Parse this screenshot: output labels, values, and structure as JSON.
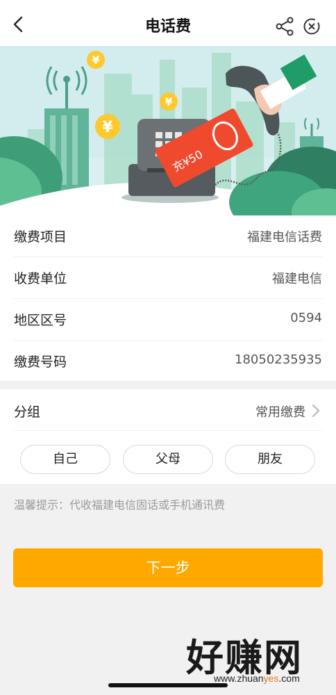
{
  "navbar": {
    "title": "电话费",
    "back_icon": "chevron-left-icon",
    "share_icon": "share-icon",
    "close_icon": "close-circle-icon"
  },
  "banner": {
    "illustration": "phone-recharge-illustration",
    "coin_symbol": "¥",
    "card_text": "充¥50"
  },
  "info": {
    "rows": [
      {
        "label": "缴费项目",
        "value": "福建电信话费"
      },
      {
        "label": "收费单位",
        "value": "福建电信"
      },
      {
        "label": "地区区号",
        "value": "0594"
      },
      {
        "label": "缴费号码",
        "value": "18050235935"
      }
    ]
  },
  "group": {
    "label": "分组",
    "value": "常用缴费",
    "options": [
      "自己",
      "父母",
      "朋友"
    ]
  },
  "tip": "温馨提示：代收福建电信固话或手机通讯费",
  "next_button": "下一步",
  "watermark": {
    "text": "好赚网",
    "url_prefix": "www.zhuan",
    "url_highlight": "yes",
    "url_suffix": ".com"
  },
  "colors": {
    "accent": "#ffa800",
    "banner_sky": "#d7eef0",
    "card_red": "#f04a2e",
    "coin_yellow": "#ffc82c"
  }
}
